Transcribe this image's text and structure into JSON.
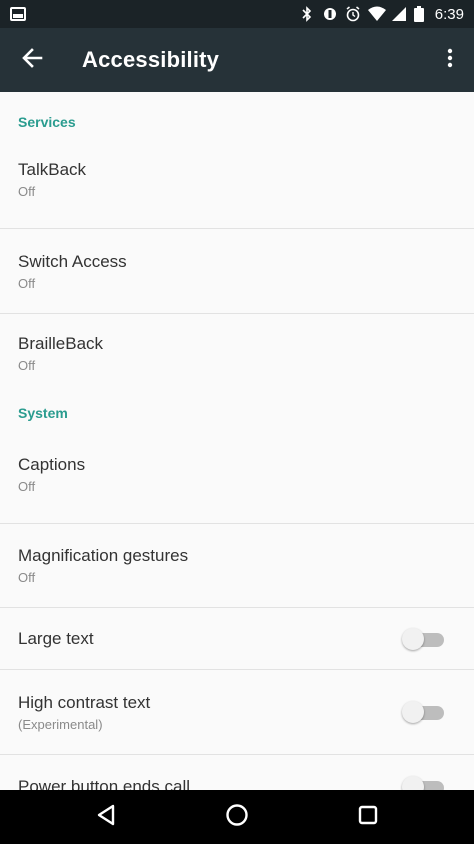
{
  "status_bar": {
    "time": "6:39",
    "icons": [
      "notification-icon",
      "bluetooth-icon",
      "vibrate-icon",
      "alarm-icon",
      "wifi-icon",
      "signal-icon",
      "battery-icon"
    ]
  },
  "app_bar": {
    "title": "Accessibility",
    "back_icon": "arrow-back-icon",
    "menu_icon": "more-vert-icon"
  },
  "sections": [
    {
      "header": "Services",
      "items": [
        {
          "title": "TalkBack",
          "summary": "Off"
        },
        {
          "title": "Switch Access",
          "summary": "Off"
        },
        {
          "title": "BrailleBack",
          "summary": "Off"
        }
      ]
    },
    {
      "header": "System",
      "items": [
        {
          "title": "Captions",
          "summary": "Off"
        },
        {
          "title": "Magnification gestures",
          "summary": "Off"
        },
        {
          "title": "Large text",
          "toggle": false
        },
        {
          "title": "High contrast text",
          "summary": "(Experimental)",
          "toggle": false
        },
        {
          "title": "Power button ends call",
          "toggle": false
        }
      ]
    }
  ],
  "nav_bar": {
    "icons": [
      "back-triangle-icon",
      "home-circle-icon",
      "recents-square-icon"
    ]
  },
  "colors": {
    "status_bar": "#1b2327",
    "app_bar": "#263238",
    "accent": "#2a9c8f",
    "background": "#fafafa"
  }
}
